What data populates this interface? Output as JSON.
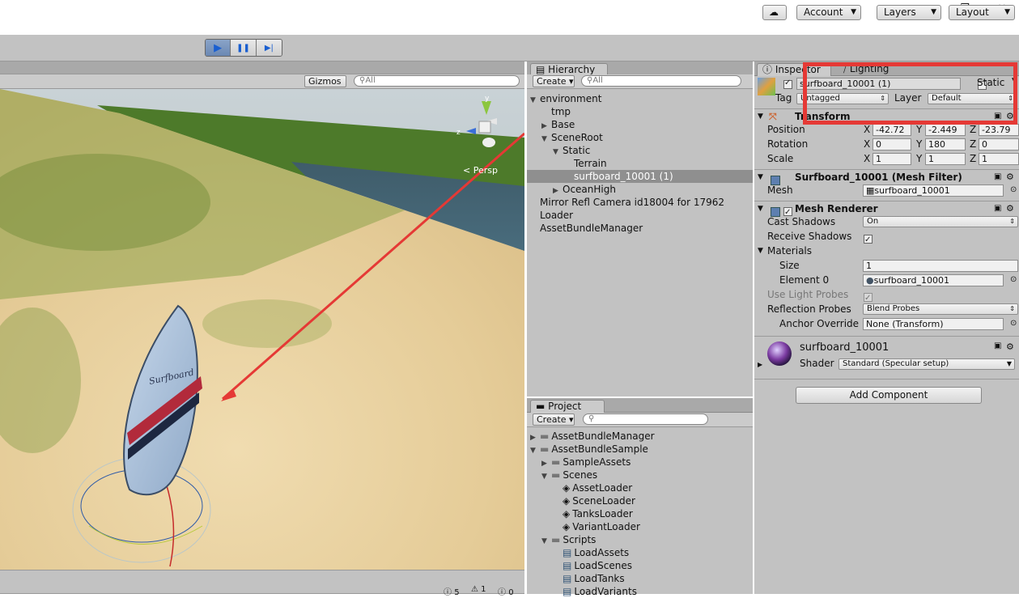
{
  "window": {
    "minimize": "—",
    "restore": "❐",
    "close": "✕"
  },
  "toolbar": {
    "play": "▶",
    "pause": "❚❚",
    "step": "▶|",
    "cloud": "☁",
    "account": "Account",
    "layers": "Layers",
    "layout": "Layout"
  },
  "scene": {
    "gizmos": "Gizmos",
    "search_placeholder": "All",
    "persp": "Persp",
    "surfboard_text": "Surfboard",
    "status": {
      "info": "5",
      "warn": "1",
      "error": "0"
    }
  },
  "hierarchy": {
    "tab": "Hierarchy",
    "create": "Create",
    "search_placeholder": "All",
    "items": [
      {
        "label": "environment",
        "indent": 0,
        "arrow": "▼"
      },
      {
        "label": "tmp",
        "indent": 1,
        "arrow": ""
      },
      {
        "label": "Base",
        "indent": 1,
        "arrow": "▶"
      },
      {
        "label": "SceneRoot",
        "indent": 1,
        "arrow": "▼"
      },
      {
        "label": "Static",
        "indent": 2,
        "arrow": "▼"
      },
      {
        "label": "Terrain",
        "indent": 3,
        "arrow": ""
      },
      {
        "label": "surfboard_10001 (1)",
        "indent": 3,
        "arrow": "",
        "selected": true
      },
      {
        "label": "OceanHigh",
        "indent": 2,
        "arrow": "▶"
      },
      {
        "label": "Mirror Refl Camera id18004 for 17962",
        "indent": 0,
        "arrow": ""
      },
      {
        "label": "Loader",
        "indent": 0,
        "arrow": ""
      },
      {
        "label": "AssetBundleManager",
        "indent": 0,
        "arrow": ""
      }
    ]
  },
  "project": {
    "tab": "Project",
    "create": "Create",
    "items": [
      {
        "label": "AssetBundleManager",
        "indent": 0,
        "arrow": "▶",
        "type": "folder"
      },
      {
        "label": "AssetBundleSample",
        "indent": 0,
        "arrow": "▼",
        "type": "folder"
      },
      {
        "label": "SampleAssets",
        "indent": 1,
        "arrow": "▶",
        "type": "folder"
      },
      {
        "label": "Scenes",
        "indent": 1,
        "arrow": "▼",
        "type": "folder"
      },
      {
        "label": "AssetLoader",
        "indent": 2,
        "arrow": "",
        "type": "unity"
      },
      {
        "label": "SceneLoader",
        "indent": 2,
        "arrow": "",
        "type": "unity"
      },
      {
        "label": "TanksLoader",
        "indent": 2,
        "arrow": "",
        "type": "unity"
      },
      {
        "label": "VariantLoader",
        "indent": 2,
        "arrow": "",
        "type": "unity"
      },
      {
        "label": "Scripts",
        "indent": 1,
        "arrow": "▼",
        "type": "folder"
      },
      {
        "label": "LoadAssets",
        "indent": 2,
        "arrow": "",
        "type": "script"
      },
      {
        "label": "LoadScenes",
        "indent": 2,
        "arrow": "",
        "type": "script"
      },
      {
        "label": "LoadTanks",
        "indent": 2,
        "arrow": "",
        "type": "script"
      },
      {
        "label": "LoadVariants",
        "indent": 2,
        "arrow": "",
        "type": "script"
      }
    ]
  },
  "inspector": {
    "tab": "Inspector",
    "tab2": "Lighting",
    "object_name": "surfboard_10001 (1)",
    "static_label": "Static",
    "tag_label": "Tag",
    "tag_value": "Untagged",
    "layer_label": "Layer",
    "layer_value": "Default",
    "transform": {
      "title": "Transform",
      "position_label": "Position",
      "position": [
        "-42.72",
        "-2.449",
        "-23.79"
      ],
      "rotation_label": "Rotation",
      "rotation": [
        "0",
        "180",
        "0"
      ],
      "scale_label": "Scale",
      "scale": [
        "1",
        "1",
        "1"
      ],
      "axes": [
        "X",
        "Y",
        "Z"
      ]
    },
    "mesh_filter": {
      "title": "Surfboard_10001 (Mesh Filter)",
      "mesh_label": "Mesh",
      "mesh_value": "surfboard_10001"
    },
    "mesh_renderer": {
      "title": "Mesh Renderer",
      "cast_shadows_label": "Cast Shadows",
      "cast_shadows": "On",
      "receive_shadows_label": "Receive Shadows",
      "materials_label": "Materials",
      "size_label": "Size",
      "size": "1",
      "element0_label": "Element 0",
      "element0": "surfboard_10001",
      "light_probes_label": "Use Light Probes",
      "reflection_label": "Reflection Probes",
      "reflection": "Blend Probes",
      "anchor_label": "Anchor Override",
      "anchor": "None (Transform)"
    },
    "material": {
      "name": "surfboard_10001",
      "shader_label": "Shader",
      "shader": "Standard (Specular setup)"
    },
    "add_component": "Add Component"
  },
  "colors": {
    "highlight_box": "#e53935",
    "arrow": "#e53935"
  }
}
